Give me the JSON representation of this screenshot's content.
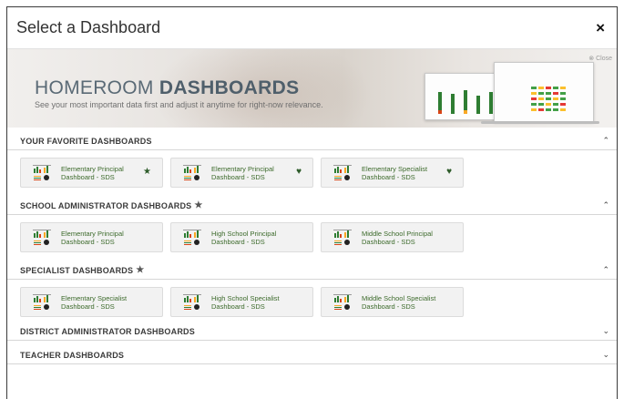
{
  "modal": {
    "title": "Select a Dashboard",
    "close_glyph": "×"
  },
  "banner": {
    "title_light": "HOMEROOM ",
    "title_bold": "DASHBOARDS",
    "subtitle": "See your most important data first and adjust it anytime for right-now relevance.",
    "close_label": "⊗ Close"
  },
  "sections": [
    {
      "title": "YOUR FAVORITE DASHBOARDS",
      "starred": false,
      "expanded": true,
      "chevron": "⌃",
      "cards": [
        {
          "line1": "Elementary Principal",
          "line2": "Dashboard - SDS",
          "fav": "★"
        },
        {
          "line1": "Elementary Principal",
          "line2": "Dashboard - SDS",
          "fav": "♥"
        },
        {
          "line1": "Elementary Specialist",
          "line2": "Dashboard - SDS",
          "fav": "♥"
        }
      ]
    },
    {
      "title": "SCHOOL ADMINISTRATOR DASHBOARDS",
      "starred": true,
      "expanded": true,
      "chevron": "⌃",
      "cards": [
        {
          "line1": "Elementary Principal",
          "line2": "Dashboard - SDS",
          "fav": ""
        },
        {
          "line1": "High School Principal",
          "line2": "Dashboard - SDS",
          "fav": ""
        },
        {
          "line1": "Middle School Principal",
          "line2": "Dashboard - SDS",
          "fav": ""
        }
      ]
    },
    {
      "title": "SPECIALIST DASHBOARDS",
      "starred": true,
      "expanded": true,
      "chevron": "⌃",
      "cards": [
        {
          "line1": "Elementary Specialist",
          "line2": "Dashboard - SDS",
          "fav": ""
        },
        {
          "line1": "High School Specialist",
          "line2": "Dashboard - SDS",
          "fav": ""
        },
        {
          "line1": "Middle School Specialist",
          "line2": "Dashboard - SDS",
          "fav": ""
        }
      ]
    },
    {
      "title": "DISTRICT ADMINISTRATOR DASHBOARDS",
      "starred": false,
      "expanded": false,
      "chevron": "⌄",
      "cards": []
    },
    {
      "title": "TEACHER DASHBOARDS",
      "starred": false,
      "expanded": false,
      "chevron": "⌄",
      "cards": []
    }
  ],
  "icons": {
    "section_star": "★",
    "dashboard_icon": "dashboard-thumbnail-icon"
  },
  "colors": {
    "card_label": "#3c6a2b",
    "fav_icon": "#2e5c2a",
    "banner_title": "#5a6a76"
  }
}
